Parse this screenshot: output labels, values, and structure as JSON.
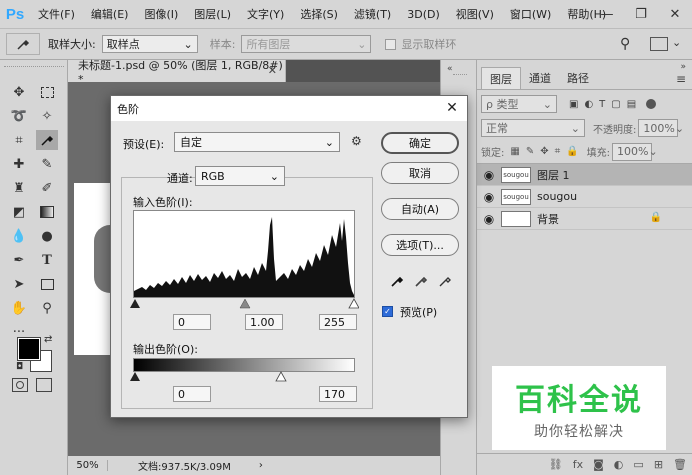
{
  "app": {
    "logo": "Ps",
    "menu": [
      "文件(F)",
      "编辑(E)",
      "图像(I)",
      "图层(L)",
      "文字(Y)",
      "选择(S)",
      "滤镜(T)",
      "3D(D)",
      "视图(V)",
      "窗口(W)",
      "帮助(H)"
    ]
  },
  "options_bar": {
    "sample_size_label": "取样大小:",
    "sample_size_value": "取样点",
    "sample_label": "样本:",
    "sample_value": "所有图层",
    "show_ring_label": "显示取样环"
  },
  "document": {
    "tab_title": "未标题-1.psd @ 50% (图层 1, RGB/8#) *",
    "zoom": "50%",
    "doc_info": "文档:937.5K/3.09M"
  },
  "layers_panel": {
    "tabs": [
      "图层",
      "通道",
      "路径"
    ],
    "filter_label": "ρ 类型",
    "blend_mode": "正常",
    "opacity_label": "不透明度:",
    "opacity_value": "100%",
    "lock_label": "锁定:",
    "fill_label": "填充:",
    "fill_value": "100%",
    "layers": [
      {
        "name": "图层 1",
        "selected": true,
        "thumb": "sougou"
      },
      {
        "name": "sougou",
        "selected": false,
        "thumb": "sougou"
      },
      {
        "name": "背景",
        "selected": false,
        "thumb": ""
      }
    ]
  },
  "levels_dialog": {
    "title": "色阶",
    "preset_label": "预设(E):",
    "preset_value": "自定",
    "channel_label": "通道:",
    "channel_value": "RGB",
    "input_label": "输入色阶(I):",
    "input_black": "0",
    "input_gamma": "1.00",
    "input_white": "255",
    "output_label": "输出色阶(O):",
    "output_black": "0",
    "output_white": "170",
    "buttons": {
      "ok": "确定",
      "cancel": "取消",
      "auto": "自动(A)",
      "options": "选项(T)..."
    },
    "preview_label": "预览(P)",
    "preview_checked": true
  },
  "watermark": {
    "title": "百科全说",
    "subtitle": "助你轻松解决"
  }
}
